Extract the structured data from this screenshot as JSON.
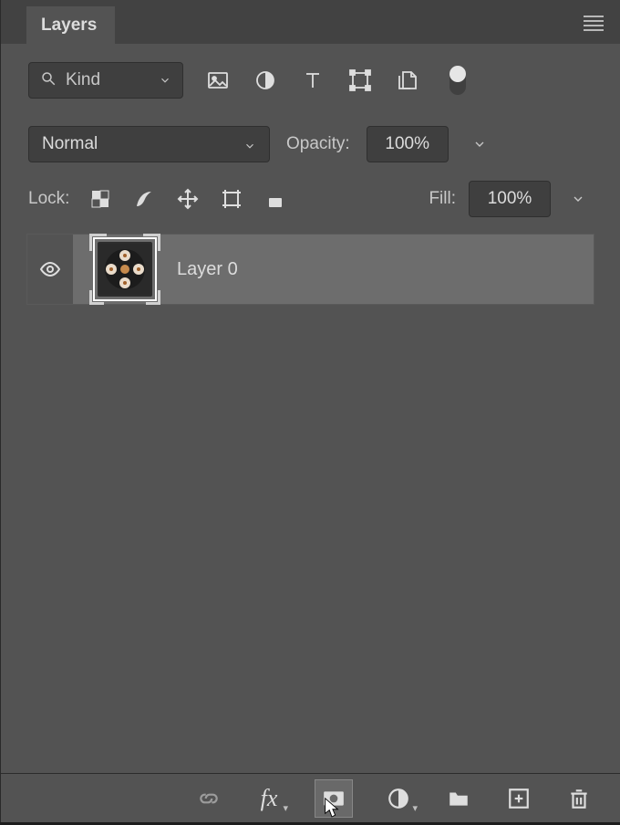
{
  "tabs": {
    "layers": "Layers"
  },
  "filter": {
    "kind_label": "Kind",
    "types": [
      "image",
      "adjustment",
      "type",
      "shape",
      "smartobject"
    ]
  },
  "blend": {
    "mode": "Normal",
    "opacity_label": "Opacity:",
    "opacity_value": "100%"
  },
  "lock": {
    "label": "Lock:",
    "fill_label": "Fill:",
    "fill_value": "100%"
  },
  "layers": [
    {
      "name": "Layer 0",
      "visible": true,
      "smart_object": true
    }
  ],
  "bottombar": {
    "link": "link-layers",
    "fx": "fx",
    "mask": "add-mask",
    "adjust": "adjustment-layer",
    "group": "new-group",
    "new": "new-layer",
    "trash": "delete-layer"
  }
}
